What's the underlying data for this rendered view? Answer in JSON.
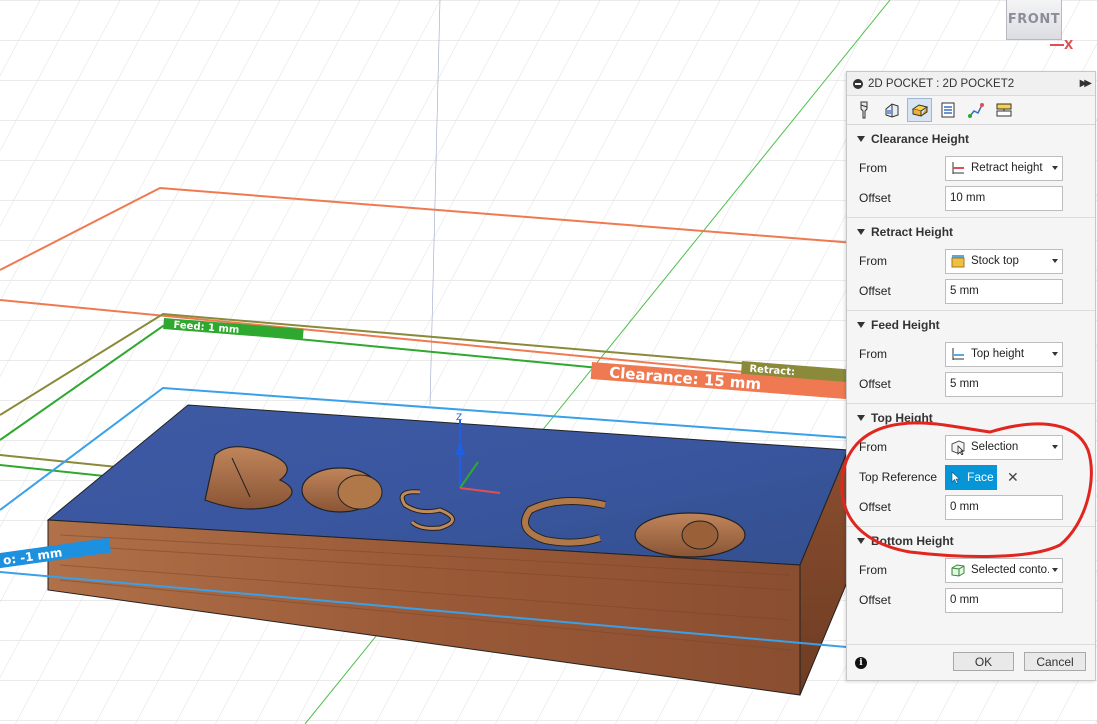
{
  "viewcube": {
    "face_label": "FRONT",
    "axis_label": "X"
  },
  "scene": {
    "feed_label": "Feed: 1 mm",
    "retract_label": "Retract:",
    "clearance_label": "Clearance: 15 mm",
    "bottom_label": "o: -1 mm",
    "z_axis_label": "Z",
    "colors": {
      "clearance": "#ef7a52",
      "retract": "#8a8a3a",
      "feed": "#2ea82e",
      "bottom": "#3aa0e8",
      "stock_top": "#3a5aa0",
      "stock_side": "#9a5a38"
    }
  },
  "panel": {
    "title": "2D POCKET : 2D POCKET2",
    "expand_icon": "double-chevron-right-icon",
    "tabs": [
      {
        "name": "tool",
        "icon": "tool-icon"
      },
      {
        "name": "geometry",
        "icon": "geometry-icon"
      },
      {
        "name": "heights",
        "icon": "heights-icon"
      },
      {
        "name": "passes",
        "icon": "passes-icon"
      },
      {
        "name": "linking",
        "icon": "linking-icon"
      },
      {
        "name": "post",
        "icon": "post-icon"
      }
    ],
    "sections": {
      "clearance": {
        "title": "Clearance Height",
        "from_label": "From",
        "from_value": "Retract height",
        "offset_label": "Offset",
        "offset_value": "10 mm"
      },
      "retract": {
        "title": "Retract Height",
        "from_label": "From",
        "from_value": "Stock top",
        "offset_label": "Offset",
        "offset_value": "5 mm"
      },
      "feed": {
        "title": "Feed Height",
        "from_label": "From",
        "from_value": "Top height",
        "offset_label": "Offset",
        "offset_value": "5 mm"
      },
      "top": {
        "title": "Top Height",
        "from_label": "From",
        "from_value": "Selection",
        "ref_label": "Top Reference",
        "ref_value": "Face",
        "offset_label": "Offset",
        "offset_value": "0 mm"
      },
      "bottom": {
        "title": "Bottom Height",
        "from_label": "From",
        "from_value": "Selected conto...",
        "offset_label": "Offset",
        "offset_value": "0 mm"
      }
    },
    "footer": {
      "info": "i",
      "ok": "OK",
      "cancel": "Cancel"
    },
    "accent": "#0696d7"
  },
  "annotation": {
    "color": "#e0261f"
  }
}
